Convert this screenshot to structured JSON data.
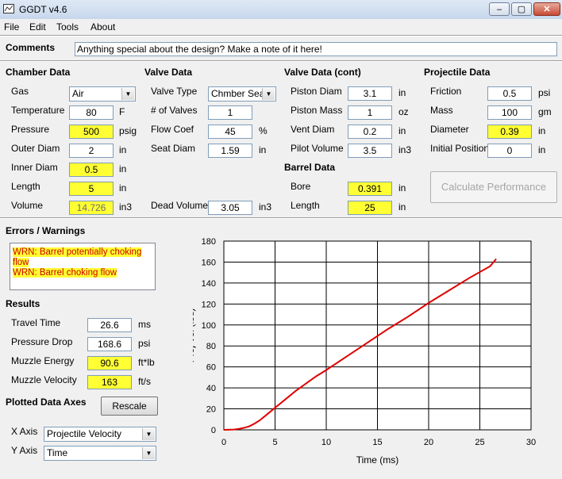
{
  "window": {
    "title": "GGDT v4.6",
    "min": "–",
    "max": "▢",
    "close": "✕"
  },
  "menu": [
    "File",
    "Edit",
    "Tools",
    "About"
  ],
  "comments": {
    "label": "Comments",
    "value": "Anything special about the design?  Make a note of it here!"
  },
  "chamber": {
    "title": "Chamber Data",
    "gas": {
      "label": "Gas",
      "value": "Air"
    },
    "temperature": {
      "label": "Temperature",
      "value": "80",
      "unit": "F"
    },
    "pressure": {
      "label": "Pressure",
      "value": "500",
      "unit": "psig"
    },
    "outer_diam": {
      "label": "Outer Diam",
      "value": "2",
      "unit": "in"
    },
    "inner_diam": {
      "label": "Inner Diam",
      "value": "0.5",
      "unit": "in"
    },
    "length": {
      "label": "Length",
      "value": "5",
      "unit": "in"
    },
    "volume": {
      "label": "Volume",
      "value": "14.726",
      "unit": "in3"
    }
  },
  "valve": {
    "title": "Valve Data",
    "type": {
      "label": "Valve Type",
      "value": "Chmber Seal"
    },
    "num_valves": {
      "label": "# of Valves",
      "value": "1"
    },
    "flow_coef": {
      "label": "Flow Coef",
      "value": "45",
      "unit": "%"
    },
    "seat_diam": {
      "label": "Seat Diam",
      "value": "1.59",
      "unit": "in"
    },
    "dead_volume": {
      "label": "Dead Volume",
      "value": "3.05",
      "unit": "in3"
    }
  },
  "valve_cont": {
    "title": "Valve Data (cont)",
    "piston_diam": {
      "label": "Piston Diam",
      "value": "3.1",
      "unit": "in"
    },
    "piston_mass": {
      "label": "Piston Mass",
      "value": "1",
      "unit": "oz"
    },
    "vent_diam": {
      "label": "Vent Diam",
      "value": "0.2",
      "unit": "in"
    },
    "pilot_volume": {
      "label": "Pilot Volume",
      "value": "3.5",
      "unit": "in3"
    }
  },
  "barrel": {
    "title": "Barrel Data",
    "bore": {
      "label": "Bore",
      "value": "0.391",
      "unit": "in"
    },
    "length": {
      "label": "Length",
      "value": "25",
      "unit": "in"
    }
  },
  "projectile": {
    "title": "Projectile Data",
    "friction": {
      "label": "Friction",
      "value": "0.5",
      "unit": "psi"
    },
    "mass": {
      "label": "Mass",
      "value": "100",
      "unit": "gm"
    },
    "diameter": {
      "label": "Diameter",
      "value": "0.39",
      "unit": "in"
    },
    "initial_position": {
      "label": "Initial Position",
      "value": "0",
      "unit": "in"
    }
  },
  "calculate_button": "Calculate Performance",
  "errors": {
    "title": "Errors / Warnings",
    "items": [
      "WRN: Barrel potentially choking",
      "flow",
      "WRN: Barrel choking flow"
    ]
  },
  "results": {
    "title": "Results",
    "travel_time": {
      "label": "Travel Time",
      "value": "26.6",
      "unit": "ms"
    },
    "pressure_drop": {
      "label": "Pressure Drop",
      "value": "168.6",
      "unit": "psi"
    },
    "muzzle_energy": {
      "label": "Muzzle Energy",
      "value": "90.6",
      "unit": "ft*lb"
    },
    "muzzle_velocity": {
      "label": "Muzzle Velocity",
      "value": "163",
      "unit": "ft/s"
    }
  },
  "plotted_axes": {
    "title": "Plotted Data Axes",
    "rescale": "Rescale",
    "x_axis": {
      "label": "X Axis",
      "value": "Projectile Velocity"
    },
    "y_axis": {
      "label": "Y Axis",
      "value": "Time"
    }
  },
  "colors": {
    "highlight": "#ffff33",
    "curve": "#e00000",
    "warning_text": "#cc0000"
  },
  "chart_data": {
    "type": "line",
    "xlabel": "Time (ms)",
    "ylabel": "Proj Vel (ft/s)",
    "xlim": [
      0,
      30
    ],
    "ylim": [
      0,
      180
    ],
    "xticks": [
      0,
      5,
      10,
      15,
      20,
      25,
      30
    ],
    "yticks": [
      0,
      20,
      40,
      60,
      80,
      100,
      120,
      140,
      160,
      180
    ],
    "grid": true,
    "series": [
      {
        "color": "#e00000",
        "x": [
          0,
          1,
          1.5,
          2,
          2.5,
          3,
          3.5,
          4,
          5,
          6,
          7,
          8,
          9,
          10,
          12,
          14,
          16,
          18,
          20,
          22,
          24,
          26,
          26.6
        ],
        "y": [
          0,
          0.3,
          1,
          2,
          3.5,
          6,
          9,
          13,
          21,
          29,
          37,
          44,
          51,
          57,
          70,
          83,
          96,
          108,
          121,
          133,
          145,
          156,
          163
        ]
      }
    ]
  }
}
